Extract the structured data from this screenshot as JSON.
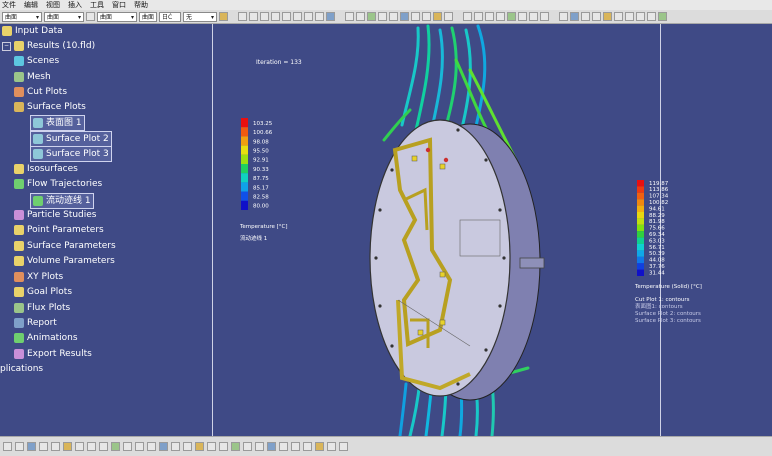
{
  "menu": [
    "文件",
    "编辑",
    "视图",
    "插入",
    "工具",
    "窗口",
    "帮助"
  ],
  "toolbar": {
    "select1": "曲面",
    "select2": "曲面",
    "select3": "曲面",
    "select4": "曲面",
    "select5": "日Ċ",
    "select6": "无"
  },
  "tree": {
    "input_data": "Input Data",
    "results": "Results (10.fld)",
    "scenes": "Scenes",
    "mesh": "Mesh",
    "cut_plots": "Cut Plots",
    "surface_plots": "Surface Plots",
    "surface_plot_items": [
      "表面图 1",
      "Surface Plot 2",
      "Surface Plot 3"
    ],
    "isosurfaces": "Isosurfaces",
    "flow_trajectories": "Flow Trajectories",
    "flow_trajectory_item": "流动迹线 1",
    "particle_studies": "Particle Studies",
    "point_parameters": "Point Parameters",
    "surface_parameters": "Surface Parameters",
    "volume_parameters": "Volume Parameters",
    "xy_plots": "XY Plots",
    "goal_plots": "Goal Plots",
    "flux_plots": "Flux Plots",
    "report": "Report",
    "animations": "Animations",
    "export_results": "Export Results",
    "applications": "plications"
  },
  "viewport": {
    "iteration": "Iteration = 133"
  },
  "legend_left": {
    "values": [
      "103.25",
      "100.66",
      "98.08",
      "95.50",
      "92.91",
      "90.33",
      "87.75",
      "85.17",
      "82.58",
      "80.00"
    ],
    "colors": [
      "#e81010",
      "#f05a10",
      "#f0a010",
      "#e8e010",
      "#9ee010",
      "#20d060",
      "#10d0c0",
      "#10a0e8",
      "#1050e8",
      "#1010c8"
    ],
    "title": "Temperature [°C]",
    "subtitle": "流动迹线 1"
  },
  "legend_right": {
    "values": [
      "119.87",
      "113.86",
      "107.34",
      "100.82",
      "94.61",
      "88.29",
      "81.98",
      "75.66",
      "69.34",
      "63.03",
      "56.71",
      "50.39",
      "44.08",
      "37.76",
      "31.44"
    ],
    "colors": [
      "#e81010",
      "#ee3a10",
      "#f06010",
      "#f08810",
      "#f0b010",
      "#e8d810",
      "#c0e010",
      "#80e010",
      "#30d040",
      "#10d090",
      "#10d0d0",
      "#10a8e8",
      "#1078e8",
      "#1040e0",
      "#1010c8"
    ],
    "title": "Temperature (Solid) [°C]",
    "plots": [
      "Cut Plot 1: contours",
      "表面图1: contours",
      "Surface Plot 2: contours",
      "Surface Plot 3: contours"
    ]
  }
}
